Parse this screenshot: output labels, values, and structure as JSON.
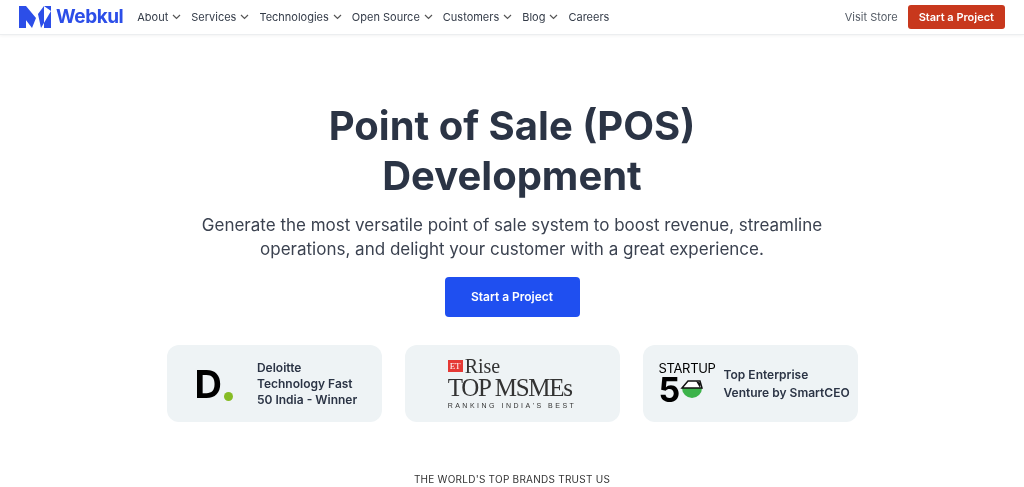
{
  "header": {
    "logo": "Webkul",
    "nav": [
      {
        "label": "About",
        "dropdown": true
      },
      {
        "label": "Services",
        "dropdown": true
      },
      {
        "label": "Technologies",
        "dropdown": true
      },
      {
        "label": "Open Source",
        "dropdown": true
      },
      {
        "label": "Customers",
        "dropdown": true
      },
      {
        "label": "Blog",
        "dropdown": true
      },
      {
        "label": "Careers",
        "dropdown": false
      }
    ],
    "link": "Visit Store",
    "cta": "Start a Project"
  },
  "hero": {
    "title_lines": [
      "Point of Sale (POS)",
      "Development"
    ],
    "subtitle_lines": [
      "Generate the most versatile point of sale system to boost revenue, streamline",
      "operations, and delight your customer with a great experience."
    ],
    "button": "Start a Project"
  },
  "awards": [
    {
      "kind": "deloitte",
      "logo": "D",
      "text_lines": [
        "Deloitte",
        "Technology Fast",
        "50 India - Winner"
      ]
    },
    {
      "kind": "etrise",
      "logo_lines": [
        "ET",
        "Rise",
        "TOP MSMEs",
        "RANKING INDIA'S BEST"
      ]
    },
    {
      "kind": "startup",
      "logo_lines": [
        "STARTUP",
        "5"
      ],
      "text_lines": [
        "Top Enterprise",
        "Venture by SmartCEO"
      ]
    }
  ],
  "brands_heading": "THE WORLD'S TOP BRANDS TRUST US"
}
